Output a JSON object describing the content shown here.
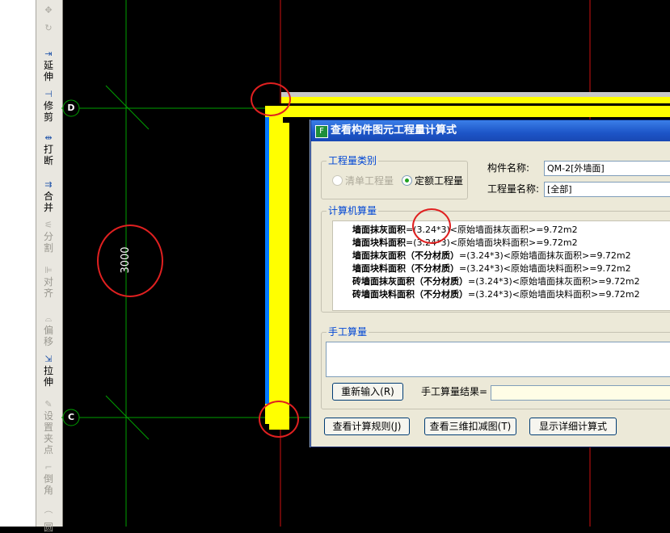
{
  "toolbar": {
    "items": [
      {
        "name": "move",
        "label": "",
        "enabled": false,
        "icon": "move-icon"
      },
      {
        "name": "rotate",
        "label": "",
        "enabled": false,
        "icon": "rotate-icon"
      },
      {
        "name": "extend",
        "label": "延\n伸",
        "enabled": true,
        "icon": "extend-icon"
      },
      {
        "name": "trim",
        "label": "修\n剪",
        "enabled": true,
        "icon": "trim-icon"
      },
      {
        "name": "break",
        "label": "打\n断",
        "enabled": true,
        "icon": "break-icon"
      },
      {
        "name": "merge",
        "label": "合\n并",
        "enabled": true,
        "icon": "merge-icon"
      },
      {
        "name": "split",
        "label": "分\n割",
        "enabled": false,
        "icon": "split-icon"
      },
      {
        "name": "align",
        "label": "对\n齐",
        "enabled": false,
        "icon": "align-icon"
      },
      {
        "name": "offset",
        "label": "偏\n移",
        "enabled": false,
        "icon": "offset-icon"
      },
      {
        "name": "stretch",
        "label": "拉\n伸",
        "enabled": true,
        "icon": "stretch-icon"
      },
      {
        "name": "set-insert-point",
        "label": "设\n置\n夹\n点",
        "enabled": false,
        "icon": "insert-point-icon"
      },
      {
        "name": "chamfer",
        "label": "倒\n角",
        "enabled": false,
        "icon": "chamfer-icon"
      },
      {
        "name": "fillet",
        "label": "圆",
        "enabled": false,
        "icon": "fillet-icon"
      }
    ]
  },
  "drawing": {
    "axis_labels": [
      "D",
      "C"
    ],
    "dimension": "3000",
    "colors": {
      "axis": "#00a000",
      "red_line": "#d01010",
      "wall": "#ffff00",
      "wall_edge": "#0078ff",
      "annotation": "#e02020"
    }
  },
  "dialog": {
    "title": "查看构件图元工程量计算式",
    "quantity_type": {
      "label": "工程量类别",
      "options": [
        {
          "label": "清单工程量",
          "selected": false,
          "enabled": false
        },
        {
          "label": "定额工程量",
          "selected": true,
          "enabled": true
        }
      ]
    },
    "component_name_label": "构件名称:",
    "component_name_value": "QM-2[外墙面]",
    "quantity_name_label": "工程量名称:",
    "quantity_name_value": "[全部]",
    "computer_calc": {
      "label": "计算机算量",
      "lines": [
        {
          "name": "墙面抹灰面积",
          "formula": "=(3.24*3)<原始墙面抹灰面积>=9.72m2"
        },
        {
          "name": "墙面块料面积",
          "formula": "=(3.24*3)<原始墙面块料面积>=9.72m2"
        },
        {
          "name": "墙面抹灰面积（不分材质）",
          "formula": "=(3.24*3)<原始墙面抹灰面积>=9.72m2"
        },
        {
          "name": "墙面块料面积（不分材质）",
          "formula": "=(3.24*3)<原始墙面块料面积>=9.72m2"
        },
        {
          "name": "砖墙面抹灰面积（不分材质）",
          "formula": "=(3.24*3)<原始墙面抹灰面积>=9.72m2"
        },
        {
          "name": "砖墙面块料面积（不分材质）",
          "formula": "=(3.24*3)<原始墙面块料面积>=9.72m2"
        }
      ]
    },
    "manual_calc": {
      "label": "手工算量",
      "value": "",
      "reenter_button": "重新输入(R)",
      "result_label": "手工算量结果=",
      "result_value": ""
    },
    "buttons": {
      "view_rules": "查看计算规则(J)",
      "view_3d": "查看三维扣减图(T)",
      "show_detail": "显示详细计算式"
    }
  }
}
